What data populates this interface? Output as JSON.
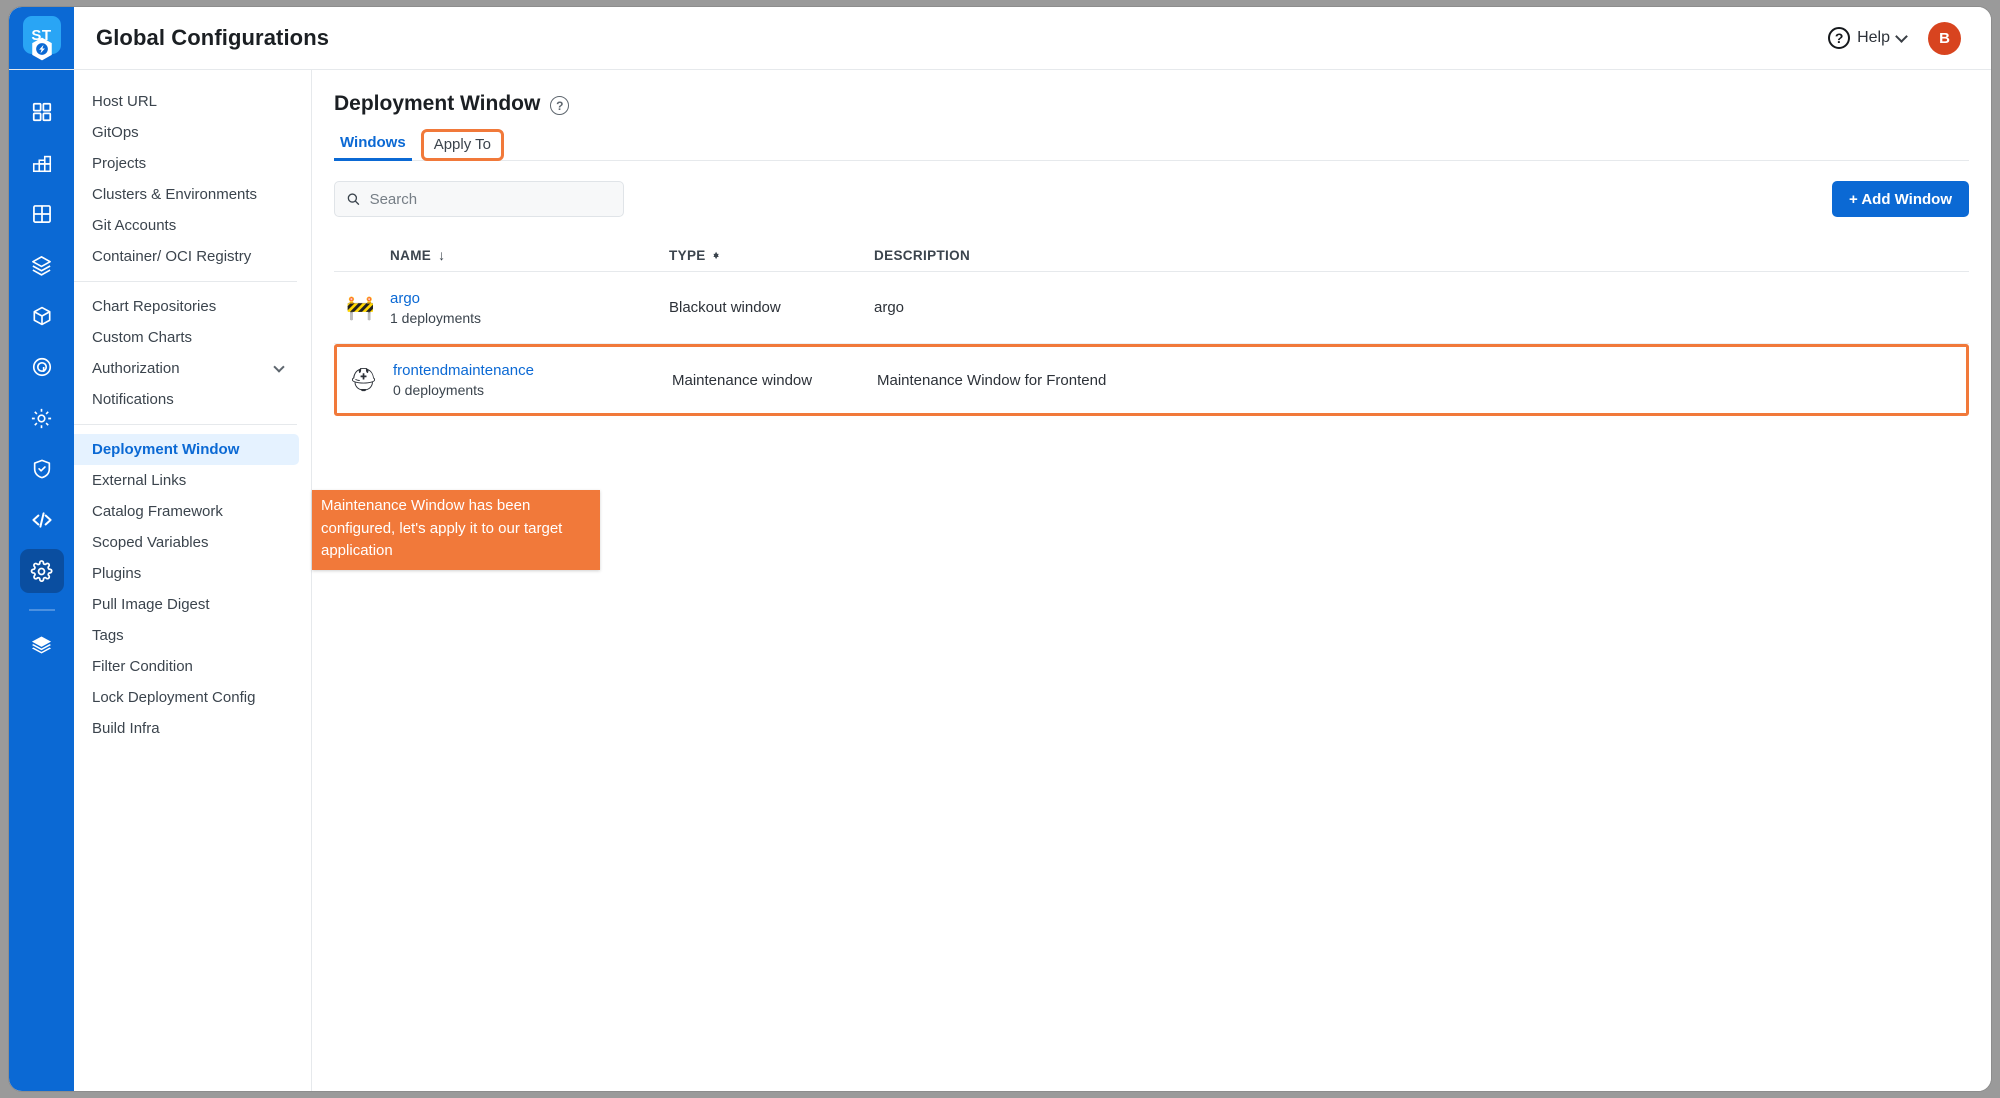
{
  "header": {
    "title": "Global Configurations",
    "help_label": "Help",
    "help_icon": "question-circle-icon",
    "help_chevron_icon": "chevron-down-icon",
    "avatar_initial": "B",
    "avatar_color": "#d8441f"
  },
  "logo": {
    "text": "ST",
    "name": "devtron-logo"
  },
  "rail": {
    "items": [
      {
        "icon": "grid-apps-icon",
        "active": false
      },
      {
        "icon": "chart-bars-icon",
        "active": false
      },
      {
        "icon": "grid-four-icon",
        "active": false
      },
      {
        "icon": "stacked-layers-icon",
        "active": false
      },
      {
        "icon": "cube-icon",
        "active": false
      },
      {
        "icon": "target-icon",
        "active": false
      },
      {
        "icon": "gear-sun-icon",
        "active": false
      },
      {
        "icon": "shield-check-icon",
        "active": false
      },
      {
        "icon": "code-brackets-icon",
        "active": false
      },
      {
        "icon": "cog-settings-icon",
        "active": true
      },
      {
        "icon": "layers-stack-icon",
        "active": false
      }
    ]
  },
  "sidebar": {
    "groups": [
      {
        "items": [
          {
            "label": "Host URL",
            "active": false
          },
          {
            "label": "GitOps",
            "active": false
          },
          {
            "label": "Projects",
            "active": false
          },
          {
            "label": "Clusters & Environments",
            "active": false
          },
          {
            "label": "Git Accounts",
            "active": false
          },
          {
            "label": "Container/ OCI Registry",
            "active": false
          }
        ]
      },
      {
        "items": [
          {
            "label": "Chart Repositories",
            "active": false
          },
          {
            "label": "Custom Charts",
            "active": false
          },
          {
            "label": "Authorization",
            "active": false,
            "expandable": true
          },
          {
            "label": "Notifications",
            "active": false
          }
        ]
      },
      {
        "items": [
          {
            "label": "Deployment Window",
            "active": true
          },
          {
            "label": "External Links",
            "active": false
          },
          {
            "label": "Catalog Framework",
            "active": false
          },
          {
            "label": "Scoped Variables",
            "active": false
          },
          {
            "label": "Plugins",
            "active": false
          },
          {
            "label": "Pull Image Digest",
            "active": false
          },
          {
            "label": "Tags",
            "active": false
          },
          {
            "label": "Filter Condition",
            "active": false
          },
          {
            "label": "Lock Deployment Config",
            "active": false
          },
          {
            "label": "Build Infra",
            "active": false
          }
        ]
      }
    ]
  },
  "main": {
    "page_title": "Deployment Window",
    "help_icon": "question-mark-icon",
    "tabs": [
      {
        "label": "Windows",
        "active": true,
        "highlighted": false
      },
      {
        "label": "Apply To",
        "active": false,
        "highlighted": true
      }
    ],
    "search": {
      "placeholder": "Search",
      "value": "",
      "icon": "search-icon"
    },
    "add_button": {
      "label": "+ Add Window",
      "icon": "plus-icon"
    },
    "table": {
      "columns": [
        {
          "label": "NAME",
          "sort": "desc",
          "sort_icon": "arrow-down-icon"
        },
        {
          "label": "TYPE",
          "sort": "none",
          "sort_icon": "sort-updown-icon"
        },
        {
          "label": "DESCRIPTION",
          "sort": "none"
        }
      ],
      "rows": [
        {
          "icon": "construction-barrier-icon",
          "icon_glyph": "🚧",
          "name": "argo",
          "deployments": "1 deployments",
          "type": "Blackout window",
          "description": "argo",
          "highlighted": false
        },
        {
          "icon": "rescue-helmet-icon",
          "icon_glyph": "⛑",
          "name": "frontendmaintenance",
          "deployments": "0 deployments",
          "type": "Maintenance window",
          "description": "Maintenance Window for Frontend",
          "highlighted": true
        }
      ]
    },
    "callout": {
      "text": "Maintenance Window has been configured, let's apply it to our target application",
      "color": "#f1793a"
    }
  }
}
